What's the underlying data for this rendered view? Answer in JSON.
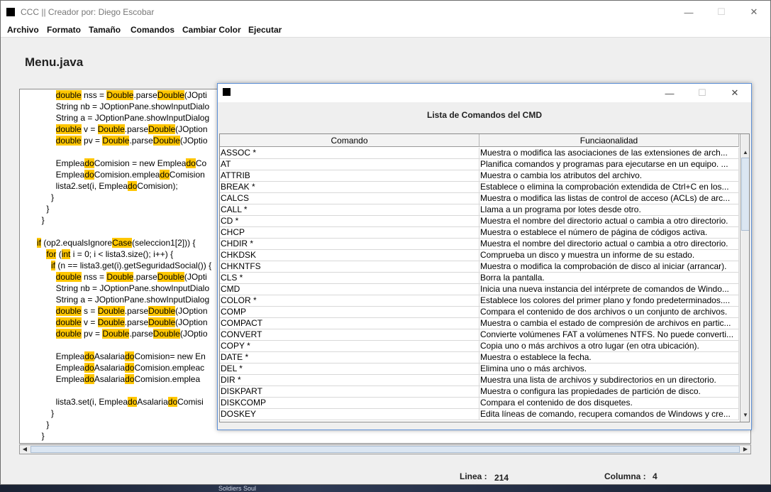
{
  "window": {
    "title": "CCC || Creador por: Diego Escobar",
    "controls": {
      "minimize": "—",
      "maximize": "☐",
      "close": "✕"
    }
  },
  "menu": [
    "Archivo",
    "Formato",
    "Tamaño",
    "Comandos",
    "Cambiar Color",
    "Ejecutar"
  ],
  "file": {
    "name": "Menu.java"
  },
  "code_lines": [
    [
      {
        "t": "        "
      },
      {
        "t": "double",
        "h": true
      },
      {
        "t": " nss = "
      },
      {
        "t": "Double",
        "h": true
      },
      {
        "t": "."
      },
      {
        "t": "parse"
      },
      {
        "t": "Double",
        "h": true
      },
      {
        "t": "(JOpti"
      }
    ],
    [
      {
        "t": "        String nb = JOptionPane.showInputDialo"
      }
    ],
    [
      {
        "t": "        String a = JOptionPane.showInputDialog"
      }
    ],
    [
      {
        "t": "        "
      },
      {
        "t": "double",
        "h": true
      },
      {
        "t": " v = "
      },
      {
        "t": "Double",
        "h": true
      },
      {
        "t": ".parse"
      },
      {
        "t": "Double",
        "h": true
      },
      {
        "t": "(JOption"
      }
    ],
    [
      {
        "t": "        "
      },
      {
        "t": "double",
        "h": true
      },
      {
        "t": " pv = "
      },
      {
        "t": "Double",
        "h": true
      },
      {
        "t": ".parse"
      },
      {
        "t": "Double",
        "h": true
      },
      {
        "t": "(JOptio"
      }
    ],
    [
      {
        "t": ""
      }
    ],
    [
      {
        "t": "        Emplea"
      },
      {
        "t": "do",
        "h": true
      },
      {
        "t": "Comision = new Emplea"
      },
      {
        "t": "do",
        "h": true
      },
      {
        "t": "Co"
      }
    ],
    [
      {
        "t": "        Emplea"
      },
      {
        "t": "do",
        "h": true
      },
      {
        "t": "Comision.emplea"
      },
      {
        "t": "do",
        "h": true
      },
      {
        "t": "Comision"
      }
    ],
    [
      {
        "t": "        lista2.set(i, Emplea"
      },
      {
        "t": "do",
        "h": true
      },
      {
        "t": "Comision);"
      }
    ],
    [
      {
        "t": "      }"
      }
    ],
    [
      {
        "t": "    }"
      }
    ],
    [
      {
        "t": "  }"
      }
    ],
    [
      {
        "t": ""
      }
    ],
    [
      {
        "t": "if",
        "h": true
      },
      {
        "t": " (op2.equalsIgnore"
      },
      {
        "t": "Case",
        "h": true
      },
      {
        "t": "(seleccion1[2])) {"
      }
    ],
    [
      {
        "t": "    "
      },
      {
        "t": "for",
        "h": true
      },
      {
        "t": " ("
      },
      {
        "t": "int",
        "h": true
      },
      {
        "t": " i = 0; i < lista3.size(); i++) {"
      }
    ],
    [
      {
        "t": "      "
      },
      {
        "t": "if",
        "h": true
      },
      {
        "t": " (n == lista3.get(i).getSeguridadSocial()) {"
      }
    ],
    [
      {
        "t": "        "
      },
      {
        "t": "double",
        "h": true
      },
      {
        "t": " nss = "
      },
      {
        "t": "Double",
        "h": true
      },
      {
        "t": ".parse"
      },
      {
        "t": "Double",
        "h": true
      },
      {
        "t": "(JOpti"
      }
    ],
    [
      {
        "t": "        String nb = JOptionPane.showInputDialo"
      }
    ],
    [
      {
        "t": "        String a = JOptionPane.showInputDialog"
      }
    ],
    [
      {
        "t": "        "
      },
      {
        "t": "double",
        "h": true
      },
      {
        "t": " s = "
      },
      {
        "t": "Double",
        "h": true
      },
      {
        "t": ".parse"
      },
      {
        "t": "Double",
        "h": true
      },
      {
        "t": "(JOption"
      }
    ],
    [
      {
        "t": "        "
      },
      {
        "t": "double",
        "h": true
      },
      {
        "t": " v = "
      },
      {
        "t": "Double",
        "h": true
      },
      {
        "t": ".parse"
      },
      {
        "t": "Double",
        "h": true
      },
      {
        "t": "(JOption"
      }
    ],
    [
      {
        "t": "        "
      },
      {
        "t": "double",
        "h": true
      },
      {
        "t": " pv = "
      },
      {
        "t": "Double",
        "h": true
      },
      {
        "t": ".parse"
      },
      {
        "t": "Double",
        "h": true
      },
      {
        "t": "(JOptio"
      }
    ],
    [
      {
        "t": ""
      }
    ],
    [
      {
        "t": "        Emplea"
      },
      {
        "t": "do",
        "h": true
      },
      {
        "t": "Asalaria"
      },
      {
        "t": "do",
        "h": true
      },
      {
        "t": "Comision= new En"
      }
    ],
    [
      {
        "t": "        Emplea"
      },
      {
        "t": "do",
        "h": true
      },
      {
        "t": "Asalaria"
      },
      {
        "t": "do",
        "h": true
      },
      {
        "t": "Comision.empleac"
      }
    ],
    [
      {
        "t": "        Emplea"
      },
      {
        "t": "do",
        "h": true
      },
      {
        "t": "Asalaria"
      },
      {
        "t": "do",
        "h": true
      },
      {
        "t": "Comision.emplea"
      }
    ],
    [
      {
        "t": ""
      }
    ],
    [
      {
        "t": "        lista3.set(i, Emplea"
      },
      {
        "t": "do",
        "h": true
      },
      {
        "t": "Asalaria"
      },
      {
        "t": "do",
        "h": true
      },
      {
        "t": "Comisi"
      }
    ],
    [
      {
        "t": "      }"
      }
    ],
    [
      {
        "t": "    }"
      }
    ],
    [
      {
        "t": "  }"
      }
    ]
  ],
  "status": {
    "linea_label": "Linea :",
    "linea_value": "214",
    "columna_label": "Columna :",
    "columna_value": "4"
  },
  "dialog": {
    "heading": "Lista de Comandos del CMD",
    "columns": [
      "Comando",
      "Funciaonalidad"
    ],
    "rows": [
      [
        "ASSOC *",
        "Muestra o modifica las asociaciones de las extensiones de arch..."
      ],
      [
        "AT",
        "Planifica comandos y programas para ejecutarse en un equipo. ..."
      ],
      [
        "ATTRIB",
        "Muestra o cambia los atributos del archivo."
      ],
      [
        "BREAK *",
        "Establece o elimina la comprobación extendida de Ctrl+C en los..."
      ],
      [
        "CALCS",
        "Muestra o modifica las listas de control de acceso (ACLs) de arc..."
      ],
      [
        "CALL *",
        "Llama a un programa por lotes desde otro."
      ],
      [
        "CD *",
        "Muestra el nombre del directorio actual o cambia a otro directorio."
      ],
      [
        "CHCP",
        "Muestra o establece el número de página de códigos activa."
      ],
      [
        "CHDIR *",
        "Muestra el nombre del directorio actual o cambia a otro directorio."
      ],
      [
        "CHKDSK",
        "Comprueba un disco y muestra un informe de su estado."
      ],
      [
        "CHKNTFS",
        "Muestra o modifica la comprobación de disco al iniciar (arrancar)."
      ],
      [
        "CLS *",
        "Borra la pantalla."
      ],
      [
        "CMD",
        "Inicia una nueva instancia del intérprete de comandos de Windo..."
      ],
      [
        "COLOR *",
        "Establece los colores del primer plano y fondo predeterminados...."
      ],
      [
        "COMP",
        "Compara el contenido de dos archivos o un conjunto de archivos."
      ],
      [
        "COMPACT",
        "Muestra o cambia el estado de compresión de archivos en partic..."
      ],
      [
        "CONVERT",
        "Convierte volúmenes FAT a volúmenes NTFS. No puede converti..."
      ],
      [
        "COPY *",
        "Copia uno o más archivos a otro lugar (en otra ubicación)."
      ],
      [
        "DATE *",
        "Muestra o establece la fecha."
      ],
      [
        "DEL *",
        "Elimina uno o más archivos."
      ],
      [
        "DIR *",
        "Muestra una lista de archivos y subdirectorios en un directorio."
      ],
      [
        "DISKPART",
        "Muestra o configura las propiedades de partición de disco."
      ],
      [
        "DISKCOMP",
        "Compara el contenido de dos disquetes."
      ],
      [
        "DOSKEY",
        "Edita líneas de comando, recupera comandos de Windows y cre..."
      ]
    ]
  },
  "desktop": {
    "label": "Soldiers Soul"
  }
}
